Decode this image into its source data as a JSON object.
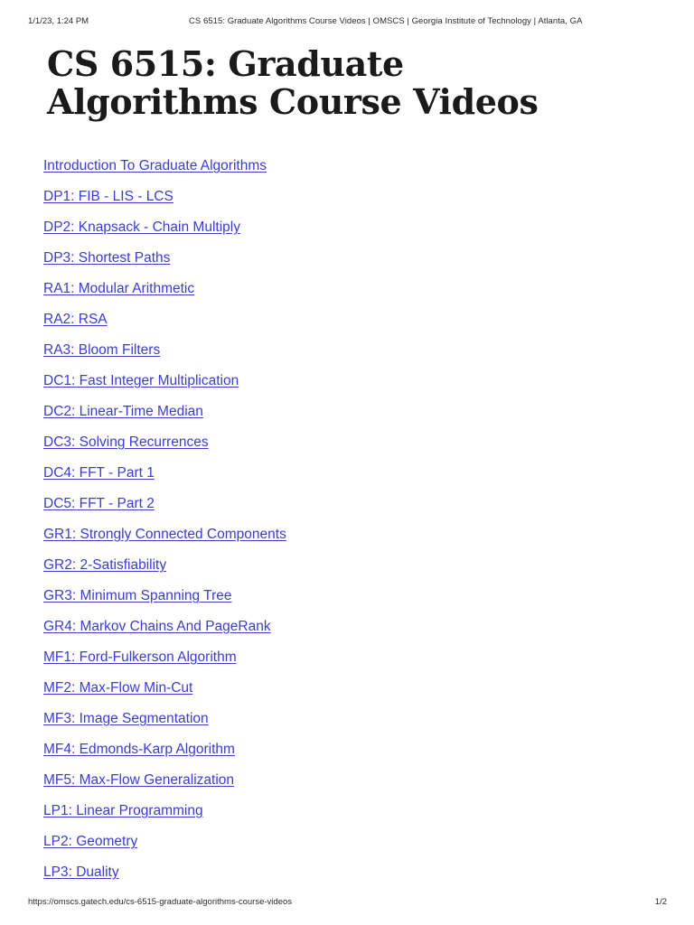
{
  "print_header": {
    "date": "1/1/23, 1:24 PM",
    "document_title": "CS 6515: Graduate Algorithms Course Videos | OMSCS | Georgia Institute of Technology | Atlanta, GA"
  },
  "page": {
    "title": "CS 6515: Graduate Algorithms Course Videos"
  },
  "colors": {
    "link": "#3b3bd6",
    "text": "#1a1a1a",
    "background": "#ffffff"
  },
  "links": [
    {
      "label": "Introduction To Graduate Algorithms"
    },
    {
      "label": "DP1: FIB - LIS - LCS"
    },
    {
      "label": "DP2: Knapsack - Chain Multiply"
    },
    {
      "label": "DP3: Shortest Paths"
    },
    {
      "label": "RA1: Modular Arithmetic"
    },
    {
      "label": "RA2: RSA"
    },
    {
      "label": "RA3: Bloom Filters"
    },
    {
      "label": "DC1: Fast Integer Multiplication"
    },
    {
      "label": "DC2: Linear-Time Median"
    },
    {
      "label": "DC3: Solving Recurrences"
    },
    {
      "label": "DC4: FFT - Part 1"
    },
    {
      "label": "DC5: FFT - Part 2"
    },
    {
      "label": "GR1: Strongly Connected Components"
    },
    {
      "label": "GR2: 2-Satisfiability"
    },
    {
      "label": "GR3: Minimum Spanning Tree"
    },
    {
      "label": "GR4: Markov Chains And PageRank"
    },
    {
      "label": "MF1: Ford-Fulkerson Algorithm"
    },
    {
      "label": "MF2: Max-Flow Min-Cut"
    },
    {
      "label": "MF3: Image Segmentation"
    },
    {
      "label": "MF4: Edmonds-Karp Algorithm"
    },
    {
      "label": "MF5: Max-Flow Generalization"
    },
    {
      "label": "LP1: Linear Programming"
    },
    {
      "label": "LP2: Geometry"
    },
    {
      "label": "LP3: Duality"
    }
  ],
  "print_footer": {
    "url": "https://omscs.gatech.edu/cs-6515-graduate-algorithms-course-videos",
    "page_number": "1/2"
  }
}
